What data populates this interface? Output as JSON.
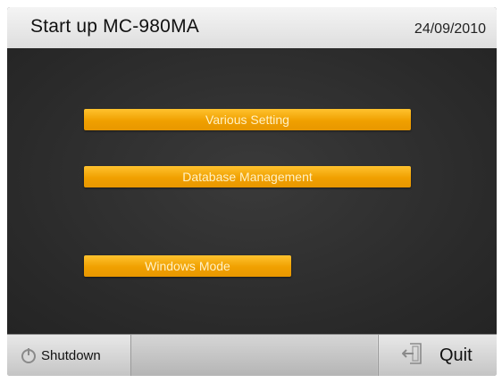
{
  "header": {
    "title": "Start up MC-980MA",
    "date": "24/09/2010"
  },
  "menu": {
    "various_setting": "Various Setting",
    "database_management": "Database Management",
    "windows_mode": "Windows Mode"
  },
  "footer": {
    "shutdown_label": "Shutdown",
    "quit_label": "Quit"
  },
  "icons": {
    "shutdown": "power-icon",
    "quit": "exit-door-icon"
  },
  "colors": {
    "accent": "#f0a000",
    "background": "#2c2c2c"
  }
}
